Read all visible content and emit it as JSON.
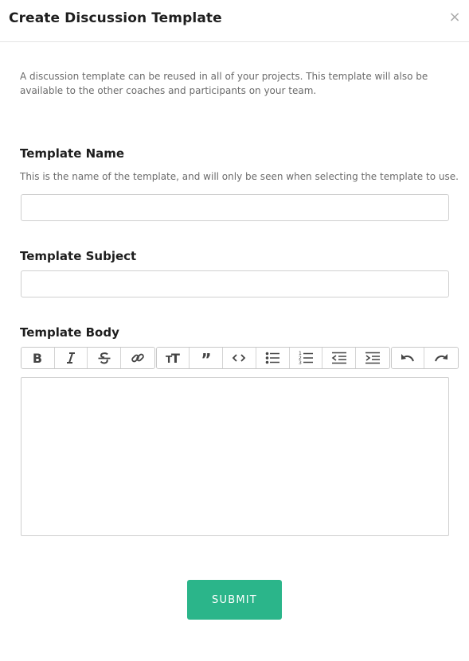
{
  "dialog": {
    "title": "Create Discussion Template",
    "close_glyph": "×"
  },
  "intro": "A discussion template can be reused in all of your projects. This template will also be available to the other coaches and participants on your team.",
  "fields": {
    "name": {
      "label": "Template Name",
      "help": "This is the name of the template, and will only be seen when selecting the template to use.",
      "value": "",
      "placeholder": ""
    },
    "subject": {
      "label": "Template Subject",
      "value": "",
      "placeholder": ""
    },
    "body": {
      "label": "Template Body",
      "value": ""
    }
  },
  "toolbar": {
    "groups": [
      [
        "bold-icon",
        "italic-icon",
        "strikethrough-icon",
        "link-icon"
      ],
      [
        "heading-icon",
        "quote-icon",
        "code-icon",
        "bullet-list-icon",
        "numbered-list-icon",
        "outdent-icon",
        "indent-icon"
      ],
      [
        "undo-icon",
        "redo-icon"
      ]
    ]
  },
  "submit_label": "SUBMIT",
  "colors": {
    "accent": "#2bb58a",
    "text": "#1e1e1e",
    "muted": "#6b6b6b",
    "border": "#cfcfcf",
    "icon": "#444444"
  }
}
